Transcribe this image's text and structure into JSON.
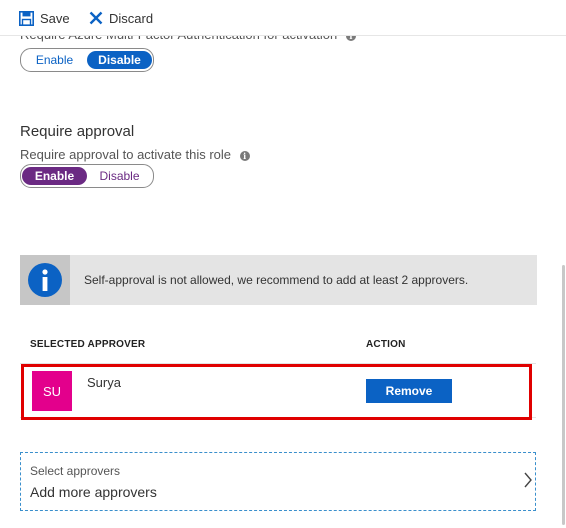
{
  "toolbar": {
    "save_label": "Save",
    "discard_label": "Discard"
  },
  "mfa": {
    "label": "Require Azure Multi-Factor Authentication for activation",
    "info_icon": "i",
    "options": [
      "Enable",
      "Disable"
    ],
    "selected": "Disable"
  },
  "approval": {
    "title": "Require approval",
    "label": "Require approval to activate this role",
    "info_icon": "i",
    "options": [
      "Enable",
      "Disable"
    ],
    "selected": "Enable"
  },
  "banner": {
    "icon": "info-icon",
    "text": "Self-approval is not allowed, we recommend to add at least 2 approvers."
  },
  "table": {
    "headers": {
      "approver": "SELECTED APPROVER",
      "action": "ACTION"
    },
    "rows": [
      {
        "initials": "SU",
        "name": "Surya",
        "action_label": "Remove"
      }
    ]
  },
  "picker": {
    "label": "Select approvers",
    "value": "Add more approvers"
  },
  "colors": {
    "accent_blue": "#0b62c4",
    "accent_purple": "#6b2a83",
    "avatar": "#e3008c",
    "highlight": "#e00000"
  }
}
